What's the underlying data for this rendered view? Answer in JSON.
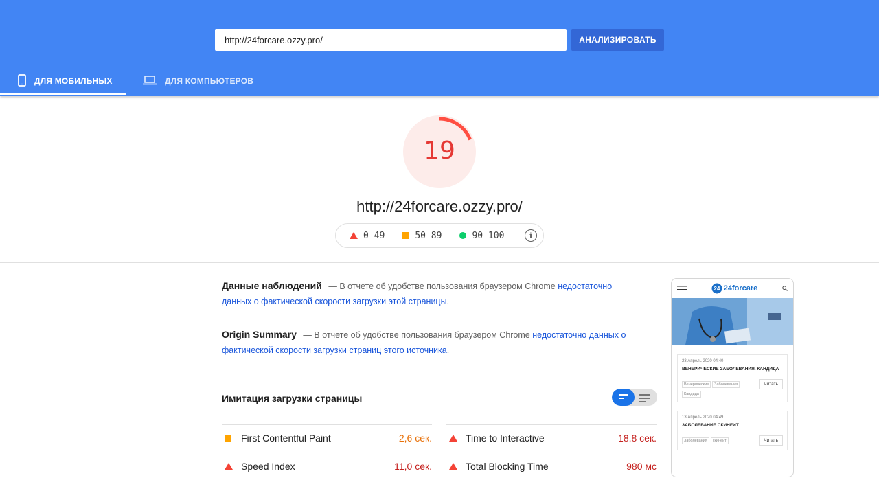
{
  "header": {
    "url_value": "http://24forcare.ozzy.pro/",
    "analyze_label": "АНАЛИЗИРОВАТЬ",
    "tabs": [
      {
        "label": "ДЛЯ МОБИЛЬНЫХ",
        "icon": "smartphone-icon",
        "active": true
      },
      {
        "label": "ДЛЯ КОМПЬЮТЕРОВ",
        "icon": "laptop-icon",
        "active": false
      }
    ],
    "color": "#4285f4"
  },
  "score": {
    "value": "19",
    "fraction": 0.19,
    "color": "#e53935",
    "url": "http://24forcare.ozzy.pro/",
    "legend": [
      {
        "range": "0–49",
        "shape": "triangle",
        "color": "#f44336"
      },
      {
        "range": "50–89",
        "shape": "square",
        "color": "#ffa400"
      },
      {
        "range": "90–100",
        "shape": "circle",
        "color": "#0cce6b"
      }
    ]
  },
  "field_data": {
    "title": "Данные наблюдений",
    "text": "— В отчете об удобстве пользования браузером Chrome",
    "link": "недостаточно данных о фактической скорости загрузки этой страницы",
    "end": "."
  },
  "origin_summary": {
    "title": "Origin Summary",
    "text": "— В отчете об удобстве пользования браузером Chrome",
    "link": "недостаточно данных о фактической скорости загрузки страниц этого источника",
    "end": "."
  },
  "lab": {
    "title": "Имитация загрузки страницы",
    "metrics": [
      {
        "name": "First Contentful Paint",
        "value": "2,6 сек.",
        "status": "average",
        "color": "#e8710a"
      },
      {
        "name": "Time to Interactive",
        "value": "18,8 сек.",
        "status": "fail",
        "color": "#c5221f"
      },
      {
        "name": "Speed Index",
        "value": "11,0 сек.",
        "status": "fail",
        "color": "#c5221f"
      },
      {
        "name": "Total Blocking Time",
        "value": "980 мс",
        "status": "fail",
        "color": "#c5221f"
      }
    ]
  },
  "preview": {
    "logo": "24forcare",
    "posts": [
      {
        "date": "23 Апрель 2020   04:40",
        "title": "ВЕНЕРИЧЕСКИЕ ЗАБОЛЕВАНИЯ. КАНДИДА",
        "tags": [
          "Венерические",
          "Заболевания",
          "Кандида"
        ],
        "read": "Читать"
      },
      {
        "date": "13 Апрель 2020   04:49",
        "title": "ЗАБОЛЕВАНИЕ СКИНЕИТ",
        "tags": [
          "Заболевания",
          "скинеит"
        ],
        "read": "Читать"
      }
    ]
  }
}
